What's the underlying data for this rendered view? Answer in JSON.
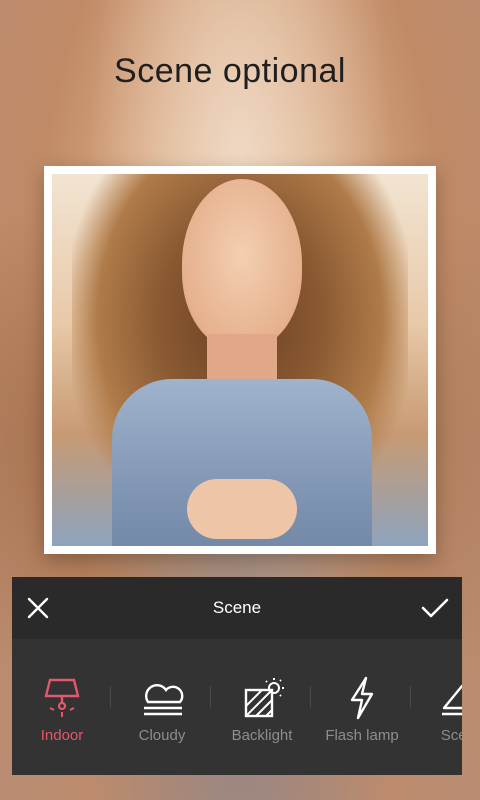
{
  "headline": "Scene optional",
  "panel": {
    "title": "Scene",
    "tools": [
      {
        "label": "Indoor",
        "icon": "lamp-icon",
        "active": true
      },
      {
        "label": "Cloudy",
        "icon": "cloud-icon",
        "active": false
      },
      {
        "label": "Backlight",
        "icon": "backlight-icon",
        "active": false
      },
      {
        "label": "Flash lamp",
        "icon": "flash-icon",
        "active": false
      },
      {
        "label": "Scene",
        "icon": "mountain-icon",
        "active": false
      }
    ]
  },
  "colors": {
    "active": "#e4576d",
    "inactive": "#8d8d8d",
    "panel_bg": "#333333",
    "panel_header_bg": "#2a2a2a"
  }
}
